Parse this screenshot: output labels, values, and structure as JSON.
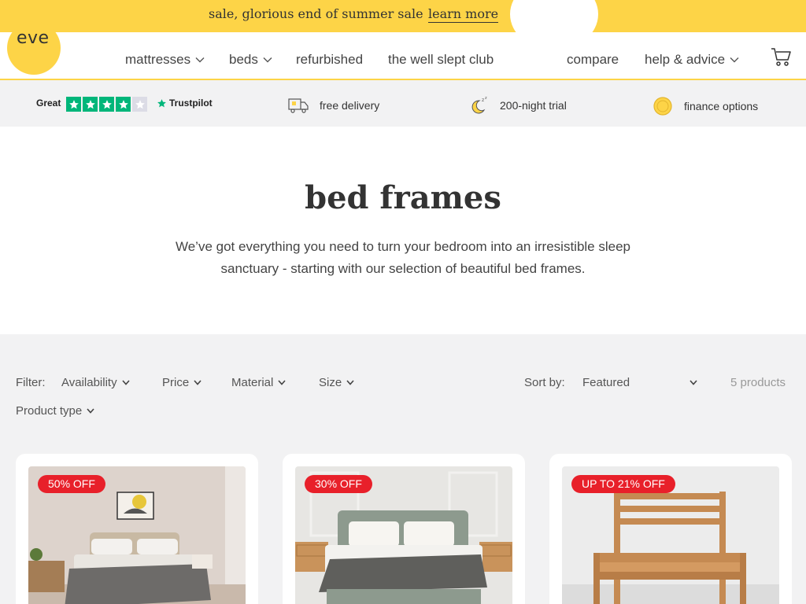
{
  "promo": {
    "text": "sale, glorious end of summer sale",
    "link": "learn more"
  },
  "header": {
    "logo": "eve",
    "nav": [
      "mattresses",
      "beds",
      "refurbished",
      "the well slept club"
    ],
    "right_nav": [
      "compare",
      "help & advice"
    ]
  },
  "usp": {
    "trustpilot_rating_label": "Great",
    "trustpilot_stars": 4,
    "trustpilot_brand": "Trustpilot",
    "items": [
      "free delivery",
      "200-night trial",
      "finance options"
    ]
  },
  "hero": {
    "title": "bed frames",
    "description": "We’ve got everything you need to turn your bedroom into an irresistible sleep sanctuary - starting with our selection of beautiful bed frames."
  },
  "filters": {
    "label": "Filter:",
    "items": [
      "Availability",
      "Price",
      "Material",
      "Size",
      "Product type"
    ],
    "sort_label": "Sort by:",
    "sort_value": "Featured",
    "count": "5 products"
  },
  "products": [
    {
      "badge": "50% OFF"
    },
    {
      "badge": "30% OFF"
    },
    {
      "badge": "UP TO 21% OFF"
    }
  ],
  "colors": {
    "brand_yellow": "#fdd447",
    "badge_red": "#e8202a",
    "trustpilot_green": "#00b67a"
  }
}
